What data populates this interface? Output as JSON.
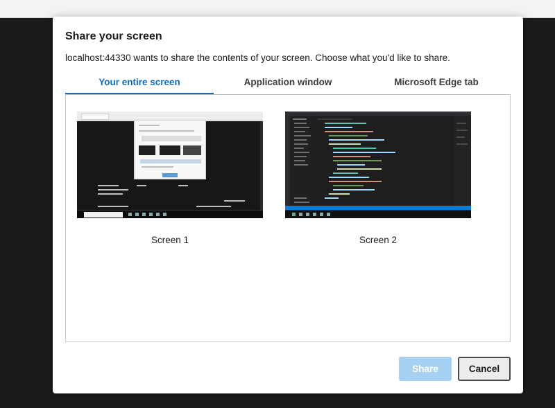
{
  "dialog": {
    "title": "Share your screen",
    "description": "localhost:44330 wants to share the contents of your screen. Choose what you'd like to share."
  },
  "tabs": [
    {
      "label": "Your entire screen",
      "active": true
    },
    {
      "label": "Application window",
      "active": false
    },
    {
      "label": "Microsoft Edge tab",
      "active": false
    }
  ],
  "screens": [
    {
      "label": "Screen 1"
    },
    {
      "label": "Screen 2"
    }
  ],
  "footer": {
    "share_label": "Share",
    "cancel_label": "Cancel"
  },
  "colors": {
    "accent": "#0f6cbd",
    "share_disabled": "#a8d1f1",
    "backdrop": "#1b1b1b"
  }
}
